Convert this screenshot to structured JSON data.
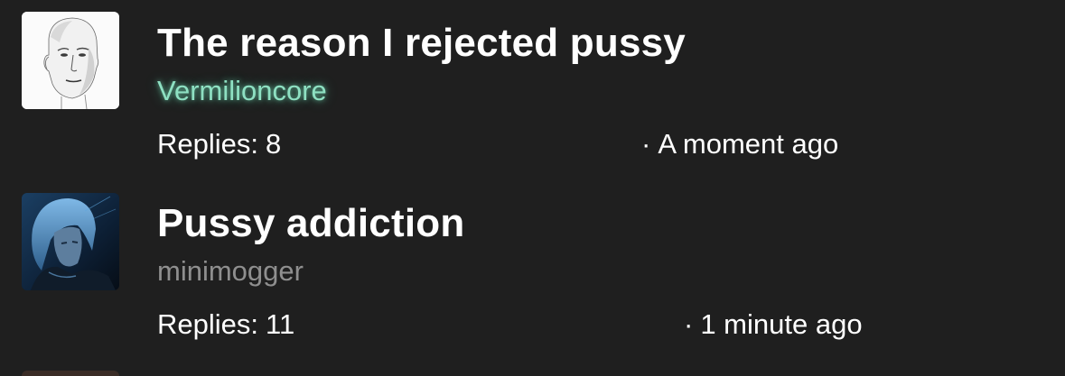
{
  "threads": [
    {
      "title": "The reason I rejected pussy",
      "author": "Vermilioncore",
      "replies_label": "Replies:",
      "replies_count": "8",
      "separator": "·",
      "time_ago": "A moment ago",
      "author_color": "#8ee0c2"
    },
    {
      "title": "Pussy addiction",
      "author": "minimogger",
      "replies_label": "Replies:",
      "replies_count": "11",
      "separator": "·",
      "time_ago": "1 minute ago",
      "author_color": "#8f8f8f"
    }
  ],
  "colors": {
    "background": "#1f1f1f",
    "text": "#ffffff",
    "muted": "#8f8f8f",
    "glow_accent": "#8ee0c2"
  }
}
